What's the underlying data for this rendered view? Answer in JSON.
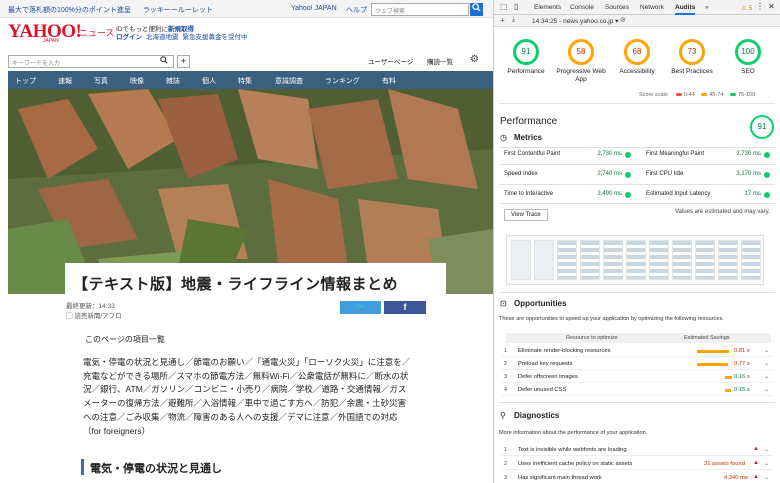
{
  "browser": {
    "promo_links": [
      "最大で落札額の100%分のポイント進呈",
      "ラッキーールーレット"
    ],
    "yahoo_japan_link": "Yahoo! JAPAN",
    "help_link": "ヘルプ",
    "web_search_placeholder": "ウェブ検索"
  },
  "site": {
    "logo": "YAHOO!",
    "logo_sub": "JAPAN",
    "section": "ニュース",
    "id_promo_text": "IDでもっと便利に",
    "id_promo_link": "新規取得",
    "login_link": "ログイン",
    "login_extra": [
      "北海道地震",
      "緊急支援募金を受付中"
    ],
    "keyword_placeholder": "キーワードを入力",
    "plus_label": "+",
    "user_page": "ユーザーページ",
    "kotoba_list": "購読一覧"
  },
  "nav_tabs": [
    "トップ",
    "速報",
    "写真",
    "映像",
    "雑誌",
    "個人",
    "特集",
    "意識調査",
    "ランキング",
    "有料"
  ],
  "article": {
    "title": "【テキスト版】地震・ライフライン情報まとめ",
    "updated": "最終更新：14:33",
    "source": "読売新聞/アフロ",
    "twitter_icon": "twitter-icon",
    "facebook_icon": "facebook-icon",
    "toc_title": "このページの項目一覧",
    "toc_body": "電気・停電の状況と見通し／節電のお願い／「通電火災」「ローソク火災」に注意を／充電などができる場所／スマホの節電方法／無料Wi-Fi／公衆電話が無料に／断水の状況／銀行、ATM／ガソリン／コンビニ・小売り／病院／学校／道路・交通情報／ガスメーターの復帰方法／避難所／入浴情報／車中で過ごす方へ／防犯／余震・土砂災害への注意／ごみ収集／物流／障害のある人への支援／デマに注意／外国語での対応（for foreigners）",
    "section_heading": "電気・停電の状況と見通し"
  },
  "devtools": {
    "tabs": [
      "Elements",
      "Console",
      "Sources",
      "Network",
      "Audits",
      "»"
    ],
    "active_tab": "Audits",
    "warning_count": "5",
    "warn_icon": "⚠",
    "url_bar": "14:34:25 - news.yahoo.co.jp ▾",
    "scores": [
      {
        "value": "91",
        "label": "Performance",
        "level": "good"
      },
      {
        "value": "58",
        "label": "Progressive Web App",
        "level": "average"
      },
      {
        "value": "68",
        "label": "Accessibility",
        "level": "average"
      },
      {
        "value": "73",
        "label": "Best Practices",
        "level": "average"
      },
      {
        "value": "100",
        "label": "SEO",
        "level": "good"
      }
    ],
    "score_scale": "Score scale:",
    "scale_items": [
      "0-44",
      "45-74",
      "75-100"
    ],
    "scale_colors": [
      "#ff4e42",
      "#ffa400",
      "#0cce6b"
    ],
    "performance_title": "Performance",
    "performance_score": "91",
    "metrics_title": "Metrics",
    "metrics": [
      {
        "label": "First Contentful Paint",
        "value": "2,730 ms"
      },
      {
        "label": "First Meaningful Paint",
        "value": "2,730 ms"
      },
      {
        "label": "Speed Index",
        "value": "2,740 ms"
      },
      {
        "label": "First CPU Idle",
        "value": "3,170 ms"
      },
      {
        "label": "Time to Interactive",
        "value": "3,490 ms"
      },
      {
        "label": "Estimated Input Latency",
        "value": "17 ms"
      }
    ],
    "view_trace": "View Trace",
    "estimate_note": "Values are estimated and may vary.",
    "opportunities_title": "Opportunities",
    "opportunities_desc": "These are opportunities to speed up your application by optimizing the following resources.",
    "opp_col1": "Resource to optimize",
    "opp_col2": "Estimated Savings",
    "opportunities": [
      {
        "n": "1",
        "label": "Eliminate render-blocking resources",
        "value": "0.81 s",
        "fill": 0.95
      },
      {
        "n": "2",
        "label": "Preload key requests",
        "value": "0.77 s",
        "fill": 0.9
      },
      {
        "n": "3",
        "label": "Defer offscreen images",
        "value": "0.16 s",
        "fill": 0.2
      },
      {
        "n": "4",
        "label": "Defer unused CSS",
        "value": "0.15 s",
        "fill": 0.18
      }
    ],
    "diagnostics_title": "Diagnostics",
    "diagnostics_desc": "More information about the performance of your application.",
    "diagnostics": [
      {
        "n": "1",
        "label": "Text is invisible while webfonts are loading",
        "value": ""
      },
      {
        "n": "2",
        "label": "Uses inefficient cache policy on static assets",
        "value": "31 assets found"
      },
      {
        "n": "3",
        "label": "Has significant main thread work",
        "value": "4,340 ms"
      }
    ]
  }
}
